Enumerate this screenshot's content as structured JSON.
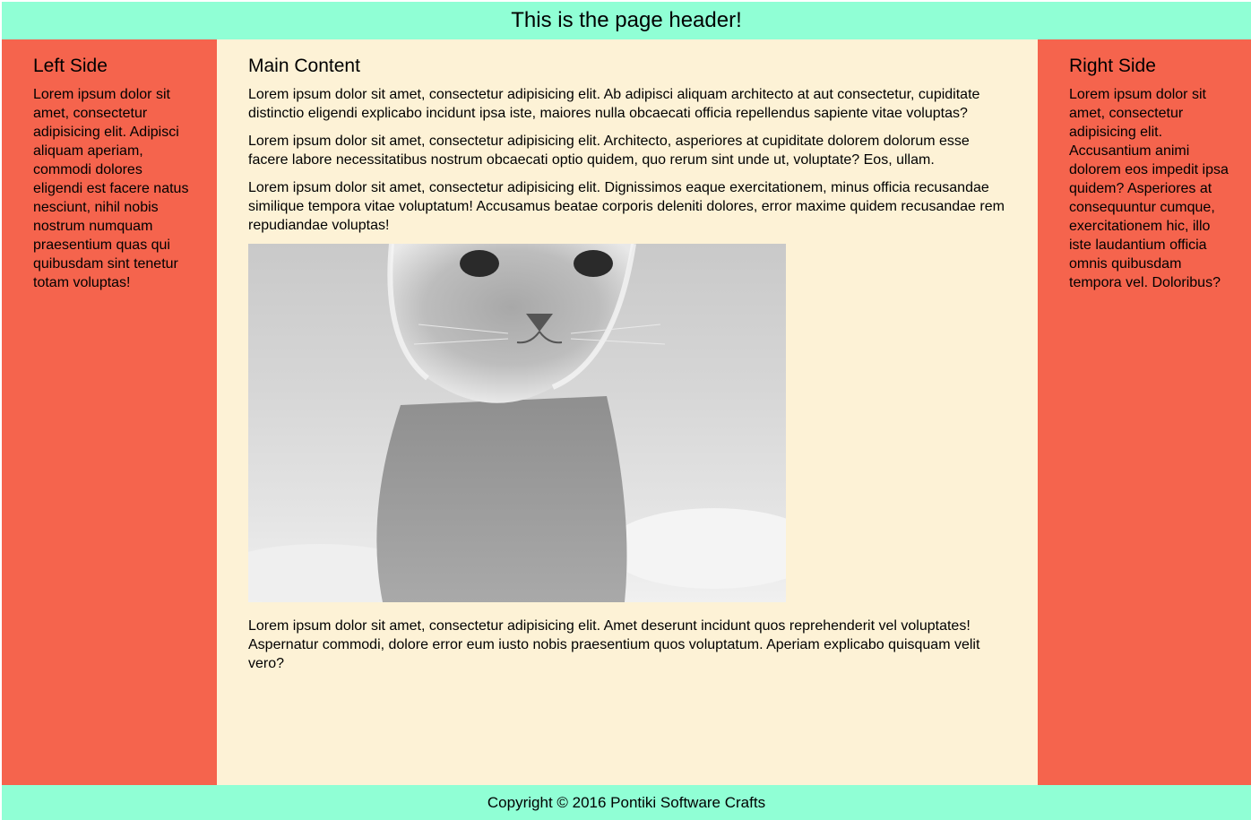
{
  "header": {
    "title": "This is the page header!"
  },
  "left": {
    "heading": "Left Side",
    "text": "Lorem ipsum dolor sit amet, consectetur adipisicing elit. Adipisci aliquam aperiam, commodi dolores eligendi est facere natus nesciunt, nihil nobis nostrum numquam praesentium quas qui quibusdam sint tenetur totam voluptas!"
  },
  "main": {
    "heading": "Main Content",
    "paragraphs": [
      "Lorem ipsum dolor sit amet, consectetur adipisicing elit. Ab adipisci aliquam architecto at aut consectetur, cupiditate distinctio eligendi explicabo incidunt ipsa iste, maiores nulla obcaecati officia repellendus sapiente vitae voluptas?",
      "Lorem ipsum dolor sit amet, consectetur adipisicing elit. Architecto, asperiores at cupiditate dolorem dolorum esse facere labore necessitatibus nostrum obcaecati optio quidem, quo rerum sint unde ut, voluptate? Eos, ullam.",
      "Lorem ipsum dolor sit amet, consectetur adipisicing elit. Dignissimos eaque exercitationem, minus officia recusandae similique tempora vitae voluptatum! Accusamus beatae corporis deleniti dolores, error maxime quidem recusandae rem repudiandae voluptas!",
      "Lorem ipsum dolor sit amet, consectetur adipisicing elit. Amet deserunt incidunt quos reprehenderit vel voluptates! Aspernatur commodi, dolore error eum iusto nobis praesentium quos voluptatum. Aperiam explicabo quisquam velit vero?"
    ],
    "image": {
      "subject": "kitten-photo"
    }
  },
  "right": {
    "heading": "Right Side",
    "text": "Lorem ipsum dolor sit amet, consectetur adipisicing elit. Accusantium animi dolorem eos impedit ipsa quidem? Asperiores at consequuntur cumque, exercitationem hic, illo iste laudantium officia omnis quibusdam tempora vel. Doloribus?"
  },
  "footer": {
    "text": "Copyright © 2016 Pontiki Software Crafts"
  },
  "colors": {
    "header_footer": "#90ffd5",
    "sidebar": "#f5644d",
    "main": "#fdf2d6"
  }
}
